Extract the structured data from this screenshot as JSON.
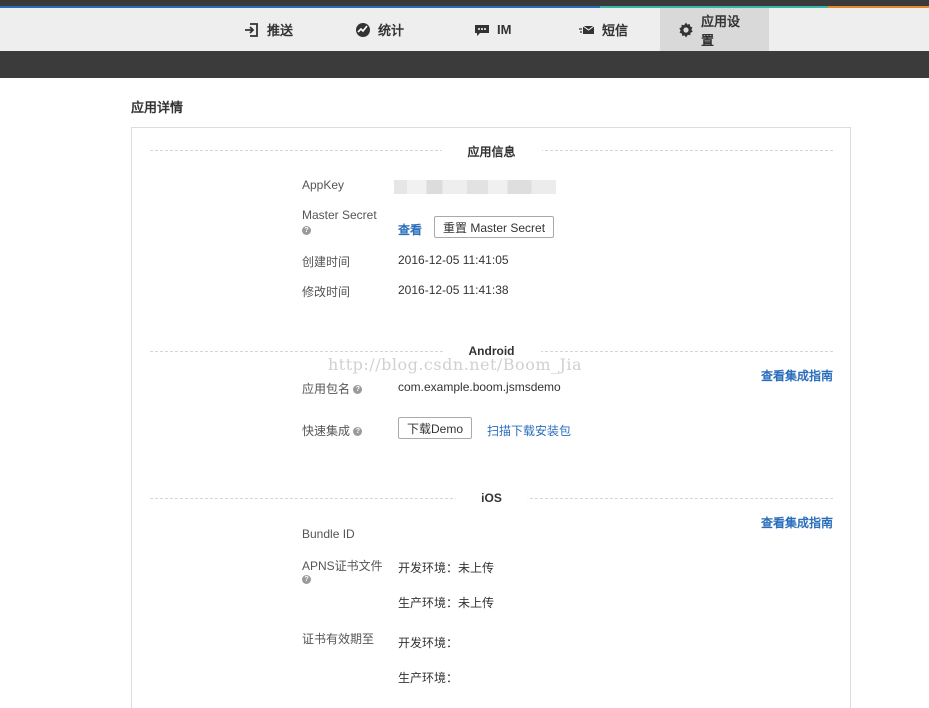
{
  "nav": {
    "items": [
      {
        "label": "推送",
        "icon": "push-icon"
      },
      {
        "label": "统计",
        "icon": "stats-icon"
      },
      {
        "label": "IM",
        "icon": "chat-icon"
      },
      {
        "label": "短信",
        "icon": "sms-icon"
      },
      {
        "label": "应用设置",
        "icon": "gear-icon",
        "active": true
      }
    ]
  },
  "page": {
    "title": "应用详情"
  },
  "app_info": {
    "heading": "应用信息",
    "appkey_label": "AppKey",
    "master_secret_label": "Master Secret",
    "view_link": "查看",
    "reset_button": "重置 Master Secret",
    "created_label": "创建时间",
    "created_value": "2016-12-05 11:41:05",
    "modified_label": "修改时间",
    "modified_value": "2016-12-05 11:41:38"
  },
  "android": {
    "heading": "Android",
    "guide_link": "查看集成指南",
    "package_label": "应用包名",
    "package_value": "com.example.boom.jsmsdemo",
    "quick_label": "快速集成",
    "download_button": "下载Demo",
    "scan_link": "扫描下载安装包"
  },
  "ios": {
    "heading": "iOS",
    "guide_link": "查看集成指南",
    "bundle_label": "Bundle ID",
    "apns_label": "APNS证书文件",
    "apns_dev": "开发环境：未上传",
    "apns_prod": "生产环境：未上传",
    "expiry_label": "证书有效期至",
    "expiry_dev": "开发环境：",
    "expiry_prod": "生产环境："
  },
  "watermark": "http://blog.csdn.net/Boom_Jia",
  "colors": {
    "link": "#2a6ebb",
    "nav_bg": "#eeeeee",
    "nav_active_bg": "#d9d9d9",
    "dark_bar": "#3b3b3b"
  }
}
